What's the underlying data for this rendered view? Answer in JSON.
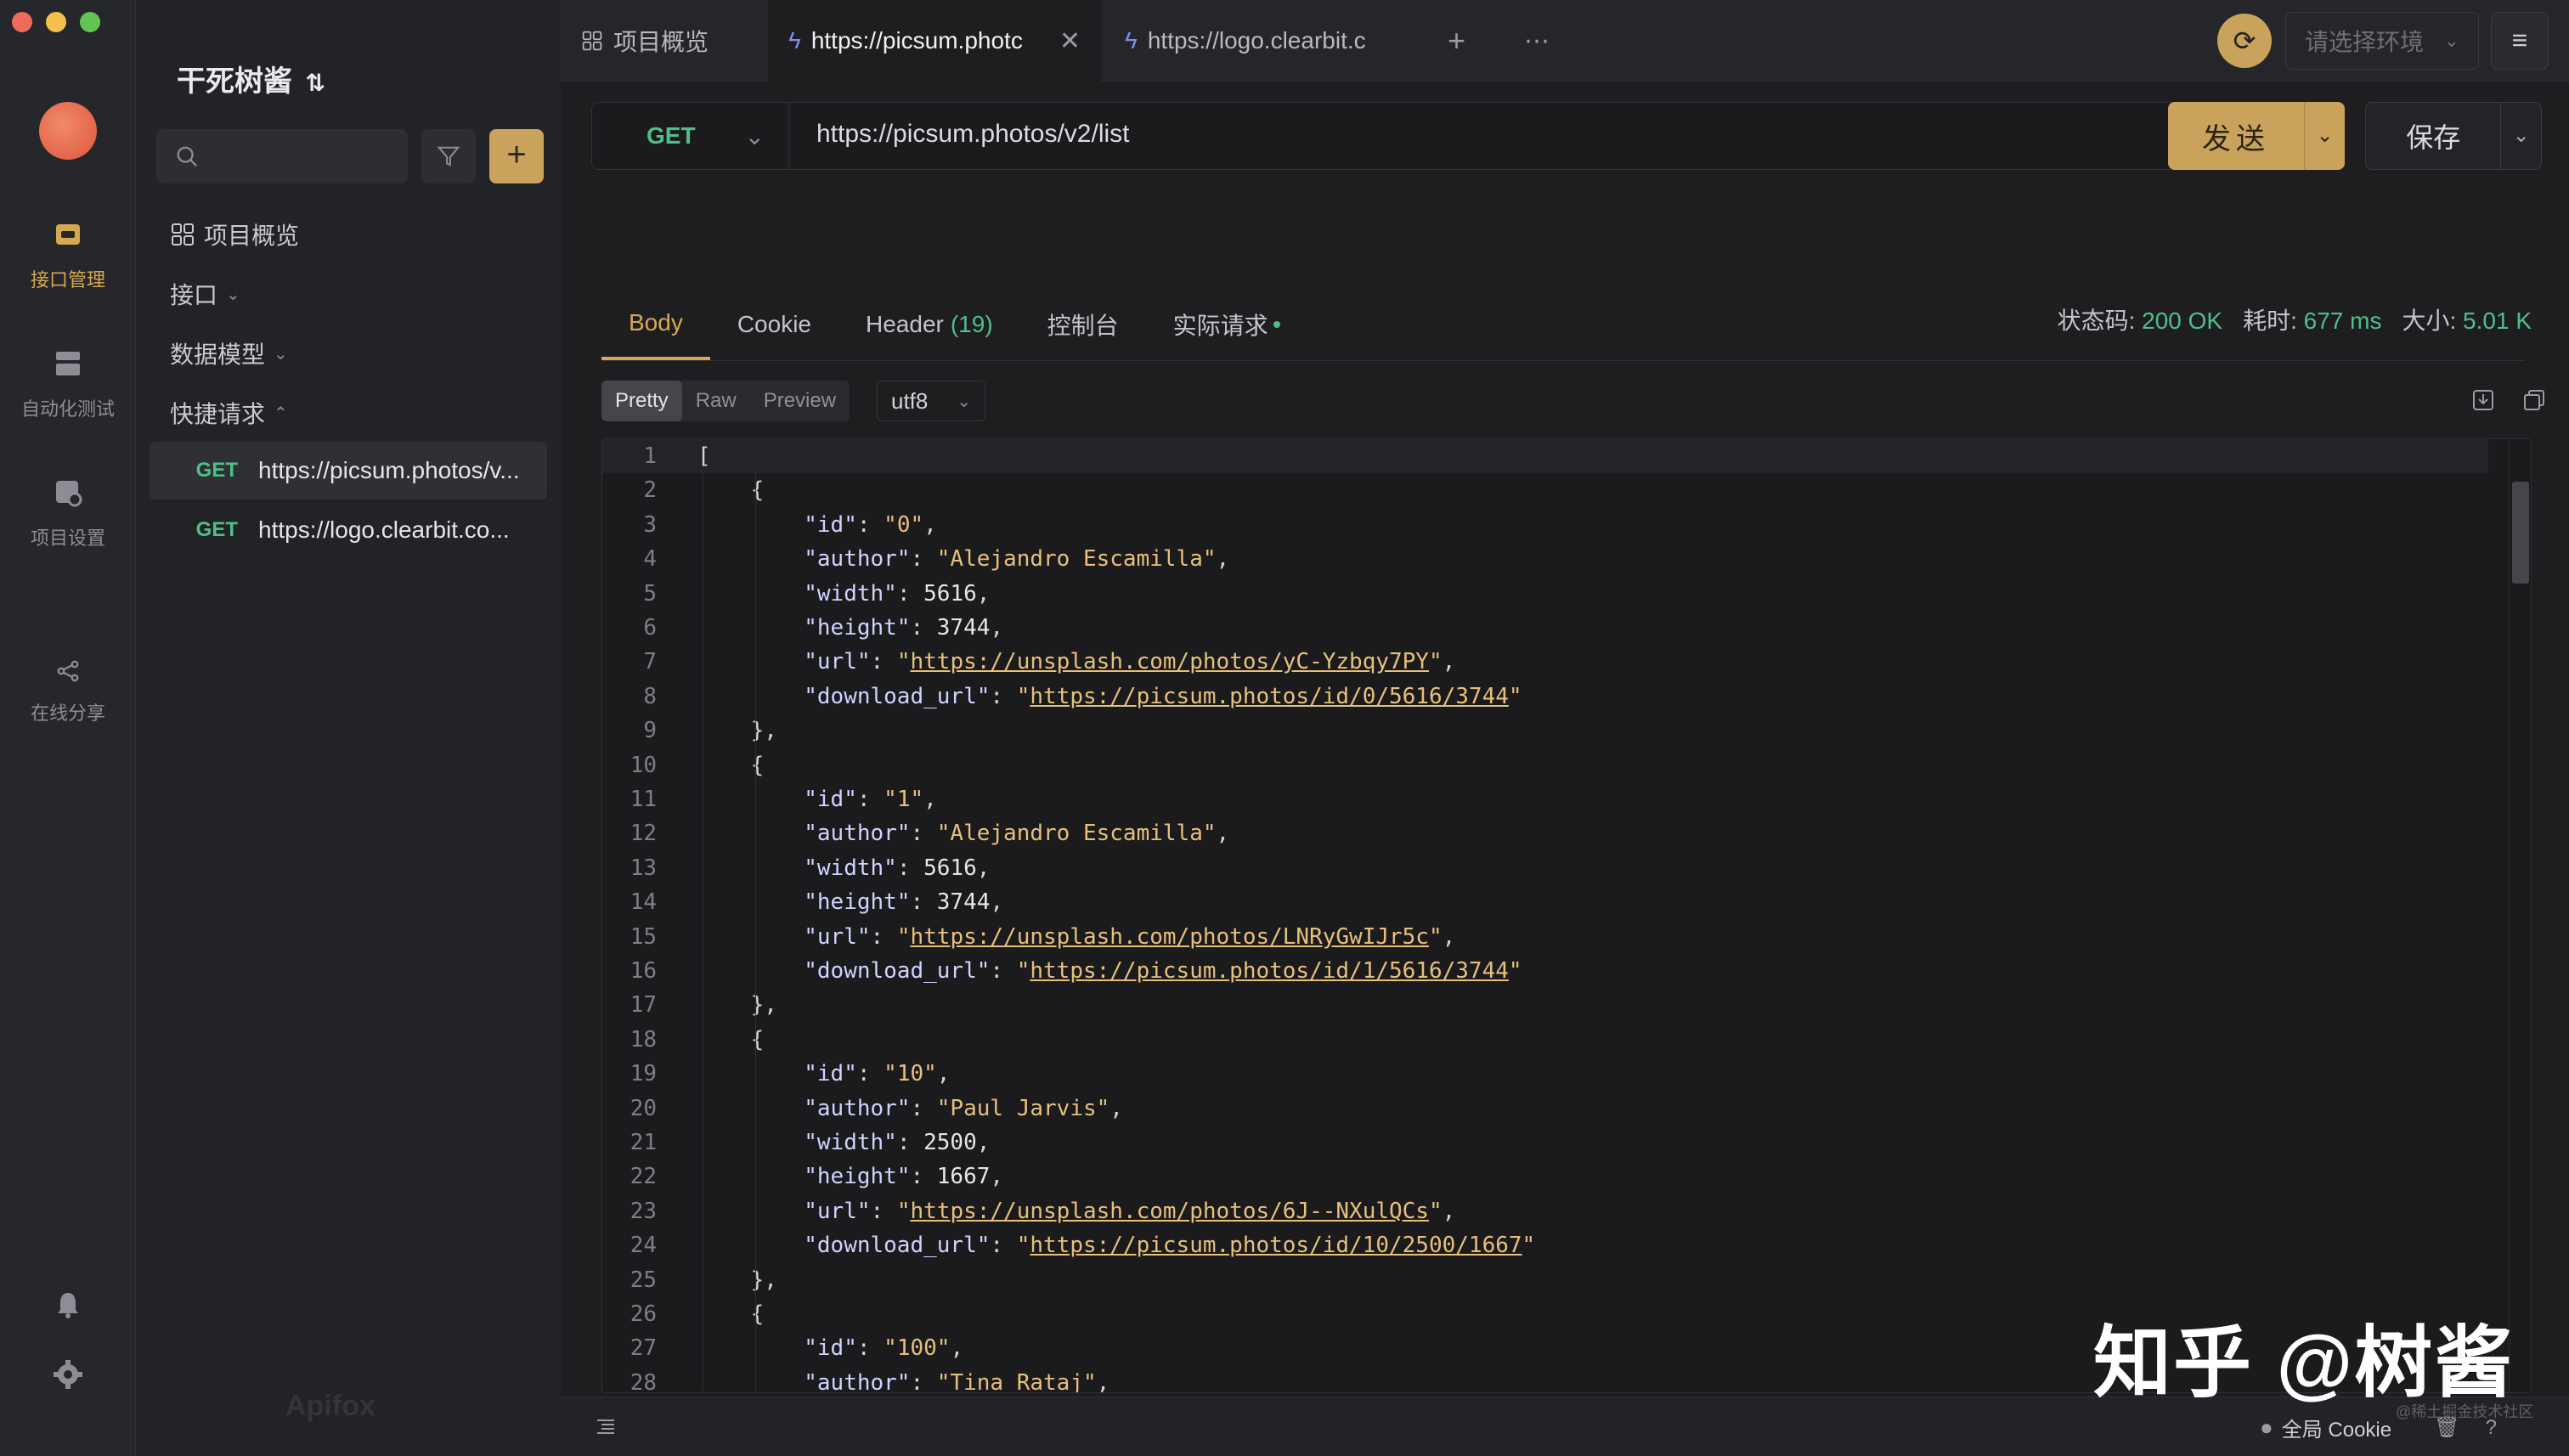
{
  "window": {
    "light_colors": [
      "#ed6a5e",
      "#f4bf4f",
      "#61c554"
    ]
  },
  "rail": {
    "items": [
      {
        "label": "接口管理",
        "icon": "api-management-icon"
      },
      {
        "label": "自动化测试",
        "icon": "automation-test-icon"
      },
      {
        "label": "项目设置",
        "icon": "project-settings-icon"
      },
      {
        "label": "在线分享",
        "icon": "share-icon"
      }
    ],
    "bottom_icons": [
      "bell-icon",
      "gear-icon"
    ]
  },
  "sidebar": {
    "project_name": "干死树酱",
    "overview": "项目概览",
    "api_group": "接口",
    "data_model": "数据模型",
    "quick_requests": "快捷请求",
    "requests": [
      {
        "method": "GET",
        "url": "https://picsum.photos/v..."
      },
      {
        "method": "GET",
        "url": "https://logo.clearbit.co..."
      }
    ],
    "watermark": "Apifox"
  },
  "tabs": [
    {
      "label": "项目概览"
    },
    {
      "label": "https://picsum.photc"
    },
    {
      "label": "https://logo.clearbit.c"
    }
  ],
  "env": {
    "placeholder": "请选择环境"
  },
  "request": {
    "method": "GET",
    "url": "https://picsum.photos/v2/list",
    "send_label": "发送",
    "save_label": "保存"
  },
  "response": {
    "tabs": [
      {
        "label": "Body"
      },
      {
        "label": "Cookie"
      },
      {
        "label": "Header",
        "count": "(19)"
      },
      {
        "label": "控制台"
      },
      {
        "label": "实际请求"
      }
    ],
    "status_label": "状态码:",
    "status_value": "200 OK",
    "time_label": "耗时:",
    "time_value": "677 ms",
    "size_label": "大小:",
    "size_value": "5.01 K",
    "formats": [
      "Pretty",
      "Raw",
      "Preview"
    ],
    "encoding": "utf8"
  },
  "body_lines": [
    "[",
    "    {",
    "        \"id\": \"0\",",
    "        \"author\": \"Alejandro Escamilla\",",
    "        \"width\": 5616,",
    "        \"height\": 3744,",
    "        \"url\": \"https://unsplash.com/photos/yC-Yzbqy7PY\",",
    "        \"download_url\": \"https://picsum.photos/id/0/5616/3744\"",
    "    },",
    "    {",
    "        \"id\": \"1\",",
    "        \"author\": \"Alejandro Escamilla\",",
    "        \"width\": 5616,",
    "        \"height\": 3744,",
    "        \"url\": \"https://unsplash.com/photos/LNRyGwIJr5c\",",
    "        \"download_url\": \"https://picsum.photos/id/1/5616/3744\"",
    "    },",
    "    {",
    "        \"id\": \"10\",",
    "        \"author\": \"Paul Jarvis\",",
    "        \"width\": 2500,",
    "        \"height\": 1667,",
    "        \"url\": \"https://unsplash.com/photos/6J--NXulQCs\",",
    "        \"download_url\": \"https://picsum.photos/id/10/2500/1667\"",
    "    },",
    "    {",
    "        \"id\": \"100\",",
    "        \"author\": \"Tina Rataj\","
  ],
  "footer": {
    "cookie_label": "全局 Cookie"
  },
  "overlay": {
    "zhihu": "知乎 @树酱",
    "juejin": "@稀土掘金技术社区"
  },
  "colors": {
    "accent": "#c9a35b",
    "method_get": "#4fbf8a",
    "link": "#7c8cf0"
  }
}
